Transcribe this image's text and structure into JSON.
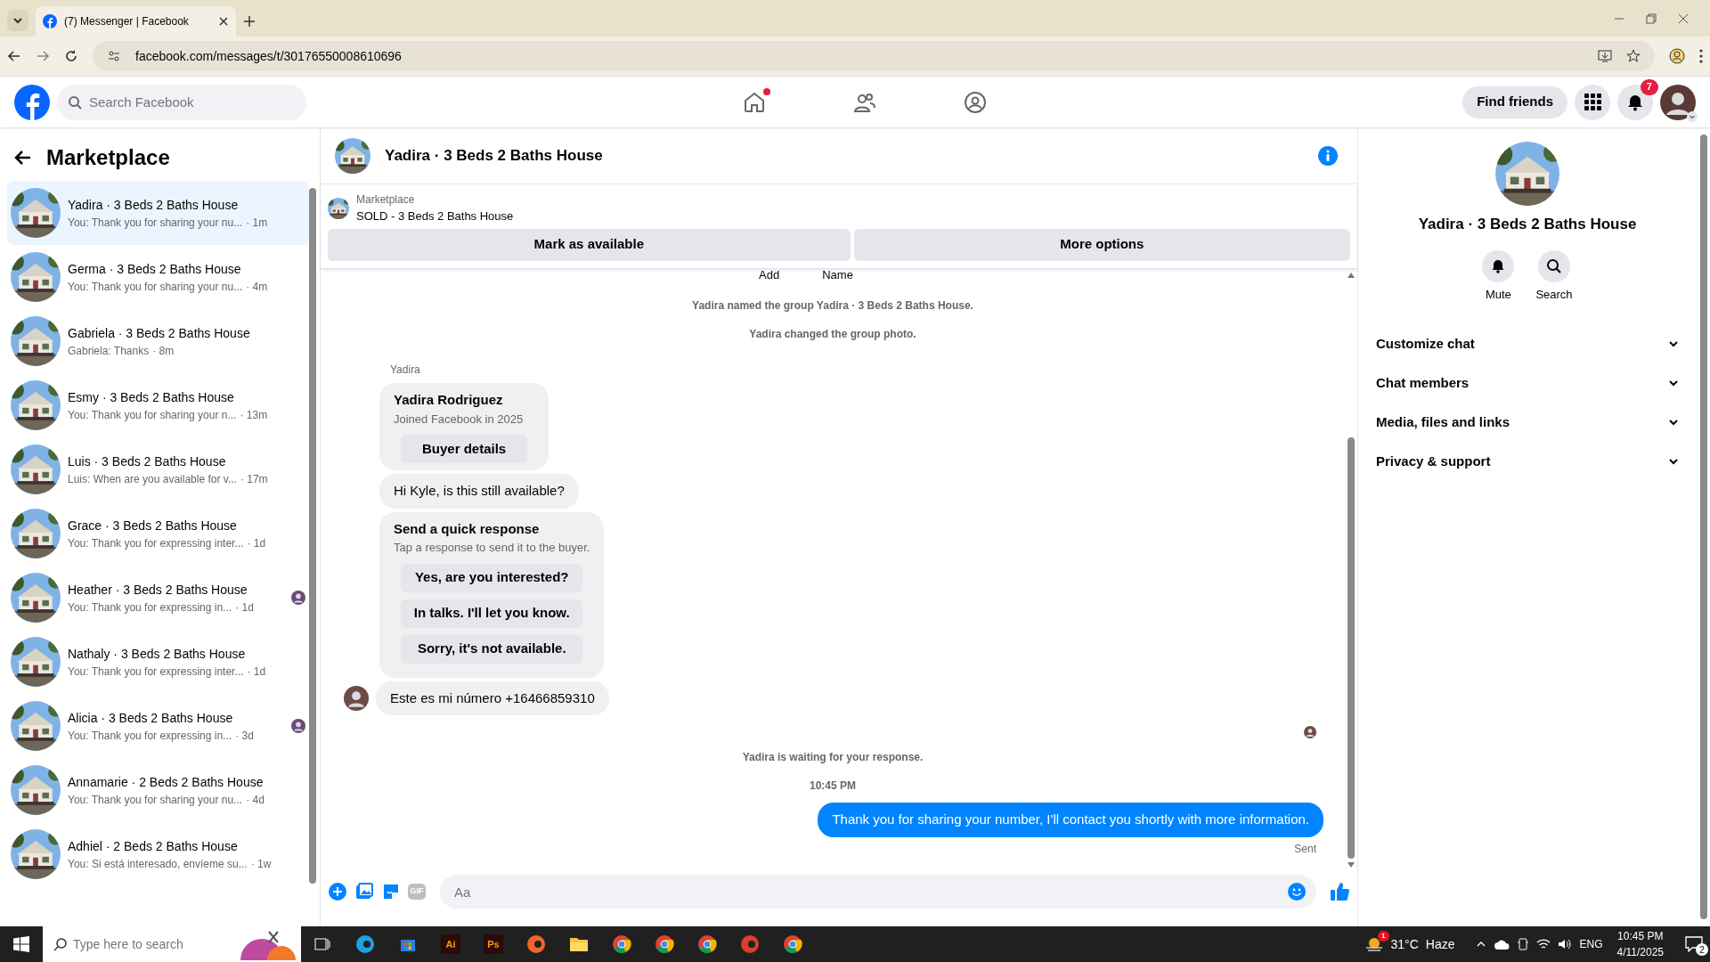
{
  "browser": {
    "tab_title": "(7) Messenger | Facebook",
    "url": "facebook.com/messages/t/30176550008610696"
  },
  "header": {
    "search_placeholder": "Search Facebook",
    "nav": [
      {
        "kind": "home",
        "dot": true
      },
      {
        "kind": "friends",
        "dot": false
      },
      {
        "kind": "groups",
        "dot": false
      }
    ],
    "find_friends": "Find friends",
    "notification_count": "7"
  },
  "sidebar": {
    "title": "Marketplace",
    "conversations": [
      {
        "title": "Yadira · 3 Beds 2 Baths House",
        "preview": "You: Thank you for sharing your nu...",
        "time": "· 1m",
        "selected": true,
        "seen": false
      },
      {
        "title": "Germa · 3 Beds 2 Baths House",
        "preview": "You: Thank you for sharing your nu...",
        "time": "· 4m",
        "selected": false,
        "seen": false
      },
      {
        "title": "Gabriela · 3 Beds 2 Baths House",
        "preview": "Gabriela: Thanks",
        "time": "· 8m",
        "selected": false,
        "seen": false
      },
      {
        "title": "Esmy · 3 Beds 2 Baths House",
        "preview": "You: Thank you for sharing your n...",
        "time": "· 13m",
        "selected": false,
        "seen": false
      },
      {
        "title": "Luis · 3 Beds 2 Baths House",
        "preview": "Luis: When are you available for v...",
        "time": "· 17m",
        "selected": false,
        "seen": false
      },
      {
        "title": "Grace · 3 Beds 2 Baths House",
        "preview": "You: Thank you for expressing inter...",
        "time": "· 1d",
        "selected": false,
        "seen": false
      },
      {
        "title": "Heather · 3 Beds 2 Baths House",
        "preview": "You: Thank you for expressing in...",
        "time": "· 1d",
        "selected": false,
        "seen": true
      },
      {
        "title": "Nathaly · 3 Beds 2 Baths House",
        "preview": "You: Thank you for expressing inter...",
        "time": "· 1d",
        "selected": false,
        "seen": false
      },
      {
        "title": "Alicia · 3 Beds 2 Baths House",
        "preview": "You: Thank you for expressing in...",
        "time": "· 3d",
        "selected": false,
        "seen": true
      },
      {
        "title": "Annamarie · 2 Beds 2 Baths House",
        "preview": "You: Thank you for sharing your nu...",
        "time": "· 4d",
        "selected": false,
        "seen": false
      },
      {
        "title": "Adhiel · 2 Beds 2 Baths House",
        "preview": "You: Si está interesado, envíeme su...",
        "time": "· 1w",
        "selected": false,
        "seen": false
      }
    ]
  },
  "chat": {
    "title": "Yadira · 3 Beds 2 Baths House",
    "listing": {
      "label": "Marketplace",
      "title": "SOLD - 3 Beds 2 Baths House"
    },
    "buttons": [
      "Mark as available",
      "More options"
    ],
    "cut_labels": [
      "Add",
      "Name"
    ],
    "messages": [
      {
        "kind": "system",
        "text": "Yadira named the group Yadira · 3 Beds 2 Baths House."
      },
      {
        "kind": "system",
        "text": "Yadira changed the group photo."
      },
      {
        "kind": "sender",
        "text": "Yadira"
      },
      {
        "kind": "profile",
        "name": "Yadira Rodriguez",
        "subtitle": "Joined Facebook in 2025",
        "button": "Buyer details"
      },
      {
        "kind": "incoming",
        "text": "Hi Kyle, is this still available?",
        "avatar": false
      },
      {
        "kind": "quick_responses",
        "title": "Send a quick response",
        "subtitle": "Tap a response to send it to the buyer.",
        "options": [
          "Yes, are you interested?",
          "In talks. I'll let you know.",
          "Sorry, it's not available."
        ]
      },
      {
        "kind": "incoming",
        "text": "Este es mi número +16466859310",
        "avatar": true
      },
      {
        "kind": "seen"
      },
      {
        "kind": "system",
        "text": "Yadira is waiting for your response."
      },
      {
        "kind": "time",
        "text": "10:45 PM"
      },
      {
        "kind": "outgoing",
        "text": "Thank you for sharing your number, I'll contact you shortly with more information."
      },
      {
        "kind": "status",
        "text": "Sent"
      }
    ],
    "composer": {
      "gif_label": "GIF",
      "placeholder": "Aa"
    }
  },
  "details": {
    "name": "Yadira · 3 Beds 2 Baths House",
    "actions": [
      {
        "kind": "mute",
        "label": "Mute"
      },
      {
        "kind": "search",
        "label": "Search"
      }
    ],
    "sections": [
      "Customize chat",
      "Chat members",
      "Media, files and links",
      "Privacy & support"
    ]
  },
  "taskbar": {
    "search_placeholder": "Type here to search",
    "apps": [
      {
        "kind": "taskview"
      },
      {
        "kind": "circle",
        "color": "#1fa0e0"
      },
      {
        "kind": "store"
      },
      {
        "kind": "label",
        "label": "Ai"
      },
      {
        "kind": "label",
        "label": "Ps"
      },
      {
        "kind": "circle",
        "color": "#f0652a"
      },
      {
        "kind": "folder"
      },
      {
        "kind": "chrome"
      },
      {
        "kind": "chrome"
      },
      {
        "kind": "chrome"
      },
      {
        "kind": "circle",
        "color": "#d8402e"
      },
      {
        "kind": "chrome"
      }
    ],
    "weather_badge": "1",
    "temperature": "31°C",
    "condition": "Haze",
    "language": "ENG",
    "time": "10:45 PM",
    "date": "4/11/2025",
    "notifications": "2"
  }
}
